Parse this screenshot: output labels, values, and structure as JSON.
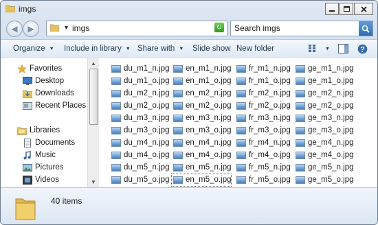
{
  "window": {
    "title": "imgs"
  },
  "address": {
    "path": "imgs"
  },
  "search": {
    "placeholder": "Search imgs"
  },
  "toolbar": {
    "organize": "Organize",
    "include_in_library": "Include in library",
    "share_with": "Share with",
    "slide_show": "Slide show",
    "new_folder": "New folder"
  },
  "nav": {
    "favorites": "Favorites",
    "desktop": "Desktop",
    "downloads": "Downloads",
    "recent_places": "Recent Places",
    "libraries": "Libraries",
    "documents": "Documents",
    "music": "Music",
    "pictures": "Pictures",
    "videos": "Videos"
  },
  "files": [
    [
      "du_m1_n.jpg",
      "en_m1_n.jpg",
      "fr_m1_n.jpg",
      "ge_m1_n.jpg"
    ],
    [
      "du_m1_o.jpg",
      "en_m1_o.jpg",
      "fr_m1_o.jpg",
      "ge_m1_o.jpg"
    ],
    [
      "du_m2_n.jpg",
      "en_m2_n.jpg",
      "fr_m2_n.jpg",
      "ge_m2_n.jpg"
    ],
    [
      "du_m2_o.jpg",
      "en_m2_o.jpg",
      "fr_m2_o.jpg",
      "ge_m2_o.jpg"
    ],
    [
      "du_m3_n.jpg",
      "en_m3_n.jpg",
      "fr_m3_n.jpg",
      "ge_m3_n.jpg"
    ],
    [
      "du_m3_o.jpg",
      "en_m3_o.jpg",
      "fr_m3_o.jpg",
      "ge_m3_o.jpg"
    ],
    [
      "du_m4_n.jpg",
      "en_m4_n.jpg",
      "fr_m4_n.jpg",
      "ge_m4_n.jpg"
    ],
    [
      "du_m4_o.jpg",
      "en_m4_o.jpg",
      "fr_m4_o.jpg",
      "ge_m4_o.jpg"
    ],
    [
      "du_m5_n.jpg",
      "en_m5_n.jpg",
      "fr_m5_n.jpg",
      "ge_m5_n.jpg"
    ],
    [
      "du_m5_o.jpg",
      "en_m5_o.jpg",
      "fr_m5_o.jpg",
      "ge_m5_o.jpg"
    ]
  ],
  "focused_file": "en_m5_o.jpg",
  "status": {
    "item_count": "40 items"
  },
  "colors": {
    "accent": "#1e395b",
    "frame": "#bfd0e6",
    "selection_border": "#555555"
  }
}
